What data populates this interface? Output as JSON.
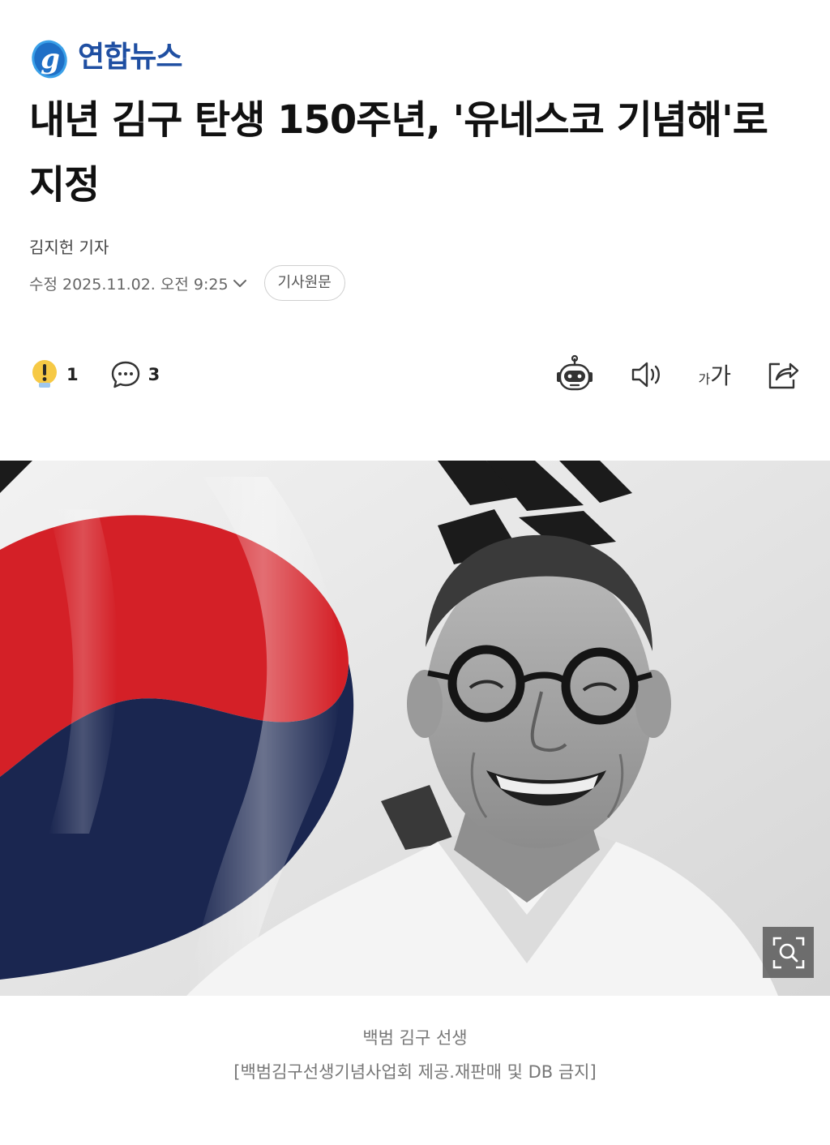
{
  "publisher": {
    "name": "연합뉴스"
  },
  "article": {
    "headline": "내년 김구 탄생 150주년, '유네스코 기념해'로 지정",
    "byline": "김지헌 기자",
    "date": "수정 2025.11.02. 오전 9:25",
    "source_button": "기사원문"
  },
  "reactions": {
    "alert_count": "1",
    "comment_count": "3"
  },
  "tools": {
    "icons": [
      "ai-bot-icon",
      "speaker-icon",
      "font-size-icon",
      "share-icon"
    ],
    "font_small": "가",
    "font_large": "가"
  },
  "photo": {
    "caption": "백범 김구 선생",
    "credit": "[백범김구선생기념사업회 제공.재판매 및 DB 금지]"
  },
  "colors": {
    "brand_blue": "#1f4fa2",
    "flag_red": "#d42027",
    "flag_blue": "#1a2650",
    "alert_yellow": "#f6c945"
  }
}
